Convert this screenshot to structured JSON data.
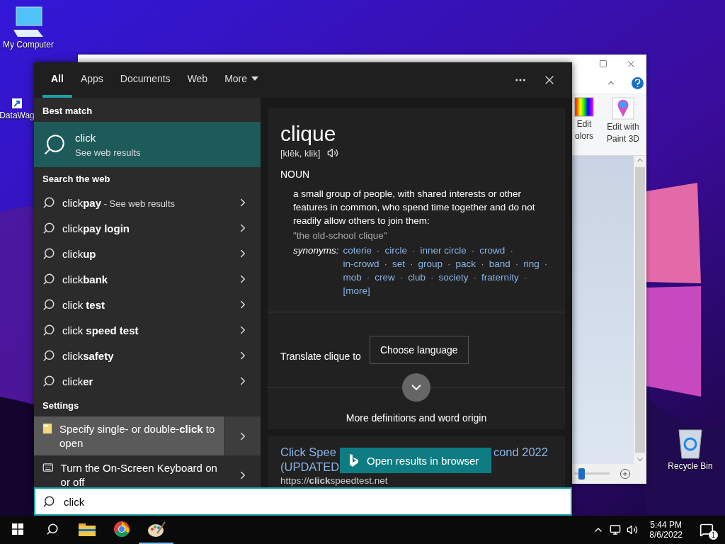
{
  "desktop": {
    "icons": [
      {
        "label": "My Computer",
        "kind": "computer"
      },
      {
        "label": "DataWag",
        "kind": "shortcut"
      },
      {
        "label": "Recycle Bin",
        "kind": "recycle"
      }
    ]
  },
  "paint_window": {
    "ribbon_buttons": [
      {
        "lines": [
          "Edit",
          "olors"
        ],
        "kind": "colors"
      },
      {
        "lines": [
          "Edit with",
          "Paint 3D"
        ],
        "kind": "paint3d"
      }
    ],
    "zoom": {
      "level": 0.2
    }
  },
  "search_panel": {
    "tabs": [
      {
        "label": "All",
        "selected": true,
        "kind": "tab"
      },
      {
        "label": "Apps",
        "selected": false,
        "kind": "tab"
      },
      {
        "label": "Documents",
        "selected": false,
        "kind": "tab"
      },
      {
        "label": "Web",
        "selected": false,
        "kind": "tab"
      },
      {
        "label": "More",
        "selected": false,
        "kind": "dropdown"
      }
    ],
    "best_match": {
      "header": "Best match",
      "title": "click",
      "subtitle": "See web results"
    },
    "web": {
      "header": "Search the web",
      "items": [
        {
          "text": "click**pay**",
          "suffix": "- See web results"
        },
        {
          "text": "click**pay login**"
        },
        {
          "text": "click**up**"
        },
        {
          "text": "click**bank**"
        },
        {
          "text": "click **test**"
        },
        {
          "text": "click **speed test**"
        },
        {
          "text": "click**safety**"
        },
        {
          "text": "click**er**"
        }
      ]
    },
    "settings": {
      "header": "Settings",
      "items": [
        {
          "text": "Specify single- or double-**click** to open",
          "kind": "settings",
          "selected": true
        },
        {
          "text": "Turn the On-Screen Keyboard on or off",
          "kind": "keyboard",
          "selected": false
        }
      ]
    },
    "definition": {
      "word": "clique",
      "pronunciation": "[klēk, klik]",
      "part_of_speech": "NOUN",
      "meaning": "a small group of people, with shared interests or other features in common, who spend time together and do not readily allow others to join them:",
      "example": "\"the old-school clique\"",
      "synonyms_label": "synonyms:",
      "separator": "·",
      "synonyms": [
        "coterie",
        "circle",
        "inner circle",
        "crowd",
        "in-crowd",
        "set",
        "group",
        "pack",
        "band",
        "ring",
        "mob",
        "crew",
        "club",
        "society",
        "fraternity"
      ],
      "more": "[more]",
      "translate_label": "Translate clique to",
      "translate_button": "Choose language",
      "more_definitions": "More definitions and word origin"
    },
    "web_result": {
      "title_parts": [
        "Click Spee",
        "cond 2022",
        "(UPDATED"
      ],
      "url": "https://**click**speedtest.net"
    },
    "open_in_browser": "Open results in browser",
    "search": {
      "value": "click"
    }
  },
  "taskbar": {
    "apps": [
      {
        "kind": "explorer",
        "active": false
      },
      {
        "kind": "chrome",
        "active": false
      },
      {
        "kind": "paint",
        "active": true
      }
    ],
    "time": "5:44 PM",
    "date": "8/6/2022",
    "notifications": "1"
  }
}
